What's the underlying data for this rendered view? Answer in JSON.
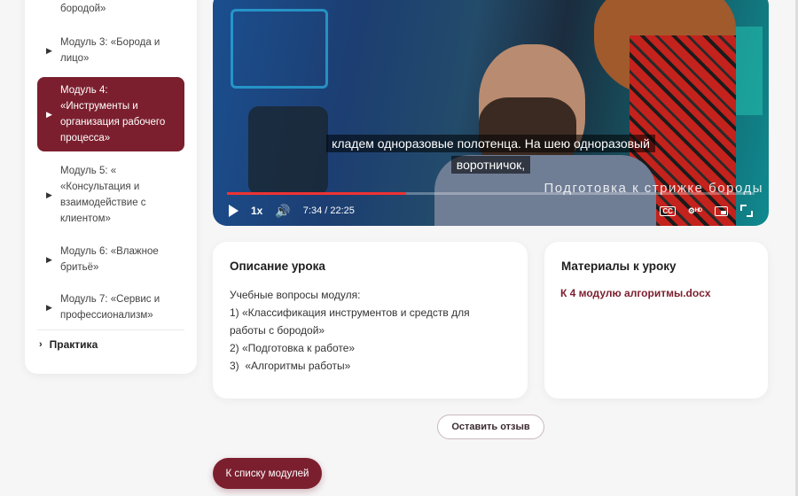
{
  "sidebar": {
    "items": [
      {
        "label": "бородой»",
        "active": false
      },
      {
        "label": "Модуль 3: «Борода и\nлицо»",
        "active": false
      },
      {
        "label": "Модуль 4:\n«Инструменты и\nорганизация рабочего\nпроцесса»",
        "active": true
      },
      {
        "label": "Модуль 5: «\n«Консультация и\nвзаимодействие с\nклиентом»",
        "active": false
      },
      {
        "label": "Модуль 6: «Влажное\nбритьё»",
        "active": false
      },
      {
        "label": "Модуль 7: «Сервис и\nпрофессионализм»",
        "active": false
      }
    ],
    "practice_label": "Практика"
  },
  "video": {
    "subtitle_line1": "кладем одноразовые полотенца. На шею одноразовый",
    "subtitle_line2": "воротничок,",
    "overlay_title": "Подготовка к стрижке бороды",
    "speed": "1x",
    "time": "7:34 / 22:25",
    "progress_fraction": 0.34,
    "icons": [
      "play-icon",
      "volume-icon",
      "cc-icon",
      "settings-hd-icon",
      "miniplayer-icon",
      "fullscreen-icon"
    ]
  },
  "description": {
    "title": "Описание урока",
    "lines": [
      "Учебные вопросы модуля:",
      "1) «Классификация инструментов и средств для",
      "работы с бородой»",
      "2) «Подготовка к работе»",
      "3)  «Алгоритмы работы»"
    ]
  },
  "materials": {
    "title": "Материалы к уроку",
    "file_link": "К 4 модулю алгоритмы.docx"
  },
  "buttons": {
    "feedback": "Оставить отзыв",
    "back_to_modules": "К списку модулей"
  },
  "colors": {
    "accent": "#7b1f2e",
    "background": "#f6f6f7",
    "card": "#ffffff"
  }
}
